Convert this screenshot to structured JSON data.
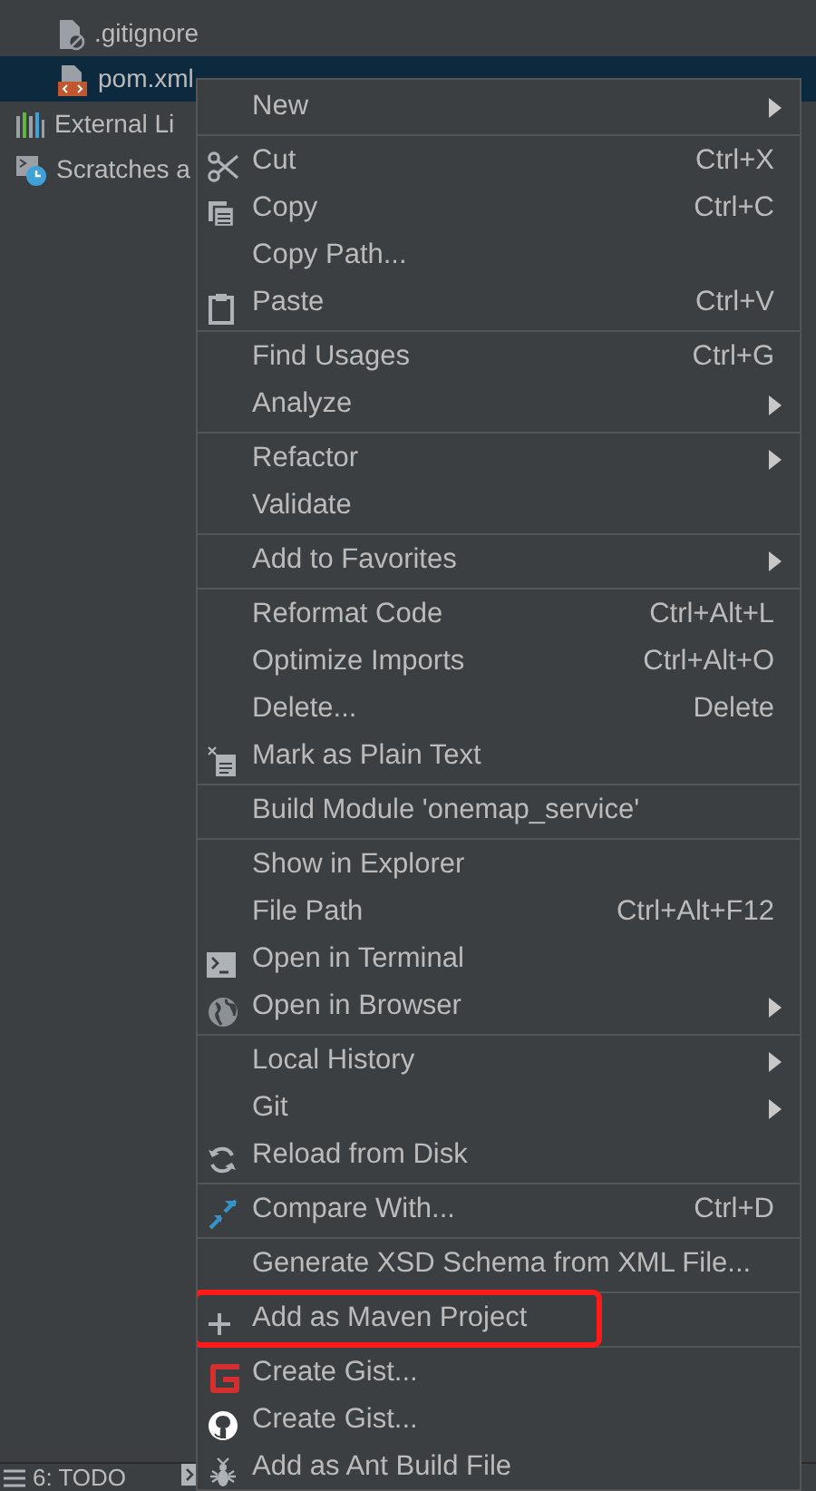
{
  "tree": [
    {
      "label": ".gitignore",
      "kind": "ignored-file",
      "selected": false,
      "indent": true
    },
    {
      "label": "pom.xml",
      "kind": "maven-file",
      "selected": true,
      "indent": true
    },
    {
      "label": "External Li",
      "kind": "libraries",
      "selected": false,
      "indent": false
    },
    {
      "label": "Scratches a",
      "kind": "scratches",
      "selected": false,
      "indent": false
    }
  ],
  "menu": {
    "sections": [
      [
        {
          "label": "New",
          "submenu": true,
          "kind": "plain",
          "outlined": false
        }
      ],
      [
        {
          "label": "Cut",
          "shortcut": "Ctrl+X",
          "submenu": false,
          "kind": "cut",
          "outlined": false
        },
        {
          "label": "Copy",
          "shortcut": "Ctrl+C",
          "submenu": false,
          "kind": "copy",
          "outlined": false
        },
        {
          "label": "Copy Path...",
          "submenu": false,
          "kind": "plain",
          "outlined": false
        },
        {
          "label": "Paste",
          "shortcut": "Ctrl+V",
          "submenu": false,
          "kind": "paste",
          "outlined": false
        }
      ],
      [
        {
          "label": "Find Usages",
          "shortcut": "Ctrl+G",
          "submenu": false,
          "kind": "plain",
          "outlined": false
        },
        {
          "label": "Analyze",
          "submenu": true,
          "kind": "plain",
          "outlined": false
        }
      ],
      [
        {
          "label": "Refactor",
          "submenu": true,
          "kind": "plain",
          "outlined": false
        },
        {
          "label": "Validate",
          "submenu": false,
          "kind": "plain",
          "outlined": false
        }
      ],
      [
        {
          "label": "Add to Favorites",
          "submenu": true,
          "kind": "plain",
          "outlined": false
        }
      ],
      [
        {
          "label": "Reformat Code",
          "shortcut": "Ctrl+Alt+L",
          "submenu": false,
          "kind": "plain",
          "outlined": false
        },
        {
          "label": "Optimize Imports",
          "shortcut": "Ctrl+Alt+O",
          "submenu": false,
          "kind": "plain",
          "outlined": false
        },
        {
          "label": "Delete...",
          "shortcut": "Delete",
          "submenu": false,
          "kind": "plain",
          "outlined": false
        },
        {
          "label": "Mark as Plain Text",
          "submenu": false,
          "kind": "plain-text",
          "outlined": false
        }
      ],
      [
        {
          "label": "Build Module 'onemap_service'",
          "submenu": false,
          "kind": "plain",
          "outlined": false
        }
      ],
      [
        {
          "label": "Show in Explorer",
          "submenu": false,
          "kind": "plain",
          "outlined": false
        },
        {
          "label": "File Path",
          "shortcut": "Ctrl+Alt+F12",
          "submenu": false,
          "kind": "plain",
          "outlined": false
        },
        {
          "label": "Open in Terminal",
          "submenu": false,
          "kind": "terminal",
          "outlined": false
        },
        {
          "label": "Open in Browser",
          "submenu": true,
          "kind": "browser",
          "outlined": false
        }
      ],
      [
        {
          "label": "Local History",
          "submenu": true,
          "kind": "plain",
          "outlined": false
        },
        {
          "label": "Git",
          "submenu": true,
          "kind": "plain",
          "outlined": false
        },
        {
          "label": "Reload from Disk",
          "submenu": false,
          "kind": "reload",
          "outlined": false
        }
      ],
      [
        {
          "label": "Compare With...",
          "shortcut": "Ctrl+D",
          "submenu": false,
          "kind": "compare",
          "outlined": false
        }
      ],
      [
        {
          "label": "Generate XSD Schema from XML File...",
          "submenu": false,
          "kind": "plain",
          "outlined": false
        }
      ],
      [
        {
          "label": "Add as Maven Project",
          "submenu": false,
          "kind": "add",
          "outlined": true
        }
      ],
      [
        {
          "label": "Create Gist...",
          "submenu": false,
          "kind": "gist",
          "outlined": false
        },
        {
          "label": "Create Gist...",
          "submenu": false,
          "kind": "github",
          "outlined": false
        },
        {
          "label": "Add as Ant Build File",
          "submenu": false,
          "kind": "ant",
          "outlined": false
        }
      ]
    ]
  },
  "status_bar": [
    {
      "label": "6: TODO",
      "kind": "todo"
    },
    {
      "kind": "terminal"
    }
  ]
}
